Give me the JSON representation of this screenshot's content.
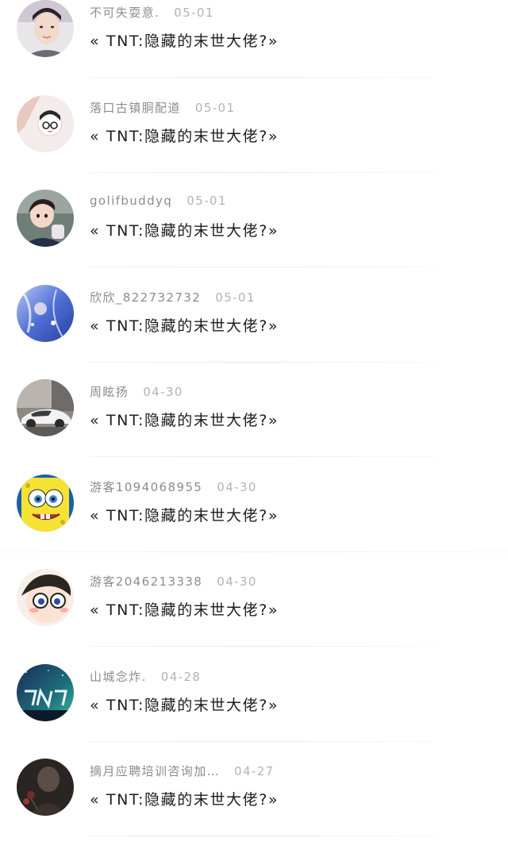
{
  "comments": [
    {
      "user": "不可失耍意.",
      "date": "05-01",
      "message": "« TNT:隐藏的末世大佬?»",
      "avatar": "portrait-young-man-avatar"
    },
    {
      "user": "落口古镇胴配道",
      "date": "05-01",
      "message": "« TNT:隐藏的末世大佬?»",
      "avatar": "cartoon-girl-glasses-avatar"
    },
    {
      "user": "golifbuddyq",
      "date": "05-01",
      "message": "« TNT:隐藏的末世大佬?»",
      "avatar": "child-photo-avatar"
    },
    {
      "user": "欣欣_822732732",
      "date": "05-01",
      "message": "« TNT:隐藏的末世大佬?»",
      "avatar": "anime-blue-art-avatar"
    },
    {
      "user": "周眩扬",
      "date": "04-30",
      "message": "« TNT:隐藏的末世大佬?»",
      "avatar": "white-car-avatar"
    },
    {
      "user": "游客1094068955",
      "date": "04-30",
      "message": "« TNT:隐藏的末世大佬?»",
      "avatar": "spongebob-avatar"
    },
    {
      "user": "游客2046213338",
      "date": "04-30",
      "message": "« TNT:隐藏的末世大佬?»",
      "avatar": "anime-detective-avatar"
    },
    {
      "user": "山城念炸.",
      "date": "04-28",
      "message": "« TNT:隐藏的末世大佬?»",
      "avatar": "tnt-logo-night-avatar"
    },
    {
      "user": "摘月应聘培训咨询加…",
      "date": "04-27",
      "message": "« TNT:隐藏的末世大佬?»",
      "avatar": "dark-photo-flower-avatar"
    }
  ]
}
